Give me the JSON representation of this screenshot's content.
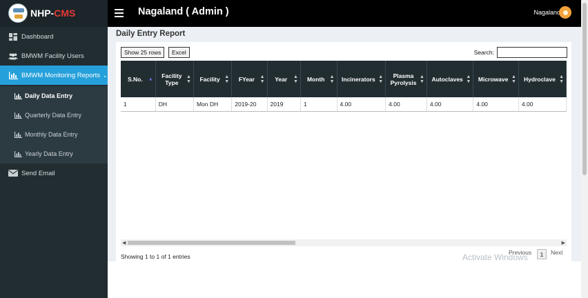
{
  "brand": {
    "name_prefix": "NHP-",
    "name_accent": "CMS"
  },
  "header": {
    "title": "Nagaland ( Admin )",
    "user": "Nagaland"
  },
  "sidebar": {
    "items": [
      {
        "label": "Dashboard",
        "icon": "dashboard-icon"
      },
      {
        "label": "BMWM Facility Users",
        "icon": "users-icon"
      },
      {
        "label": "BMWM Monitoring Reports",
        "icon": "bar-chart-icon",
        "active": true
      }
    ],
    "subitems": [
      {
        "label": "Daily Data Entry",
        "current": true
      },
      {
        "label": "Quarterly Data Entry"
      },
      {
        "label": "Monthly Data Entry"
      },
      {
        "label": "Yearly Data Entry"
      }
    ],
    "send_email": "Send Email"
  },
  "report": {
    "title": "Daily Entry Report",
    "show_rows": "Show 25 rows",
    "excel": "Excel",
    "search_label": "Search:",
    "columns": [
      "S.No.",
      "Facility Type",
      "Facility",
      "FYear",
      "Year",
      "Month",
      "Incinerators",
      "Plasma Pyrolysis",
      "Autoclaves",
      "Microwave",
      "Hydroclave"
    ],
    "rows": [
      [
        "1",
        "DH",
        "Mon DH",
        "2019-20",
        "2019",
        "1",
        "4.00",
        "4.00",
        "4.00",
        "4.00",
        "4.00"
      ]
    ],
    "info": "Showing 1 to 1 of 1 entries",
    "previous": "Previous",
    "page": "1",
    "next": "Next"
  },
  "watermark": "Activate Windows",
  "colors": {
    "accent": "#26a0da",
    "sidebar": "#222d32",
    "topbar": "#000000",
    "brand_accent": "#e53935"
  }
}
